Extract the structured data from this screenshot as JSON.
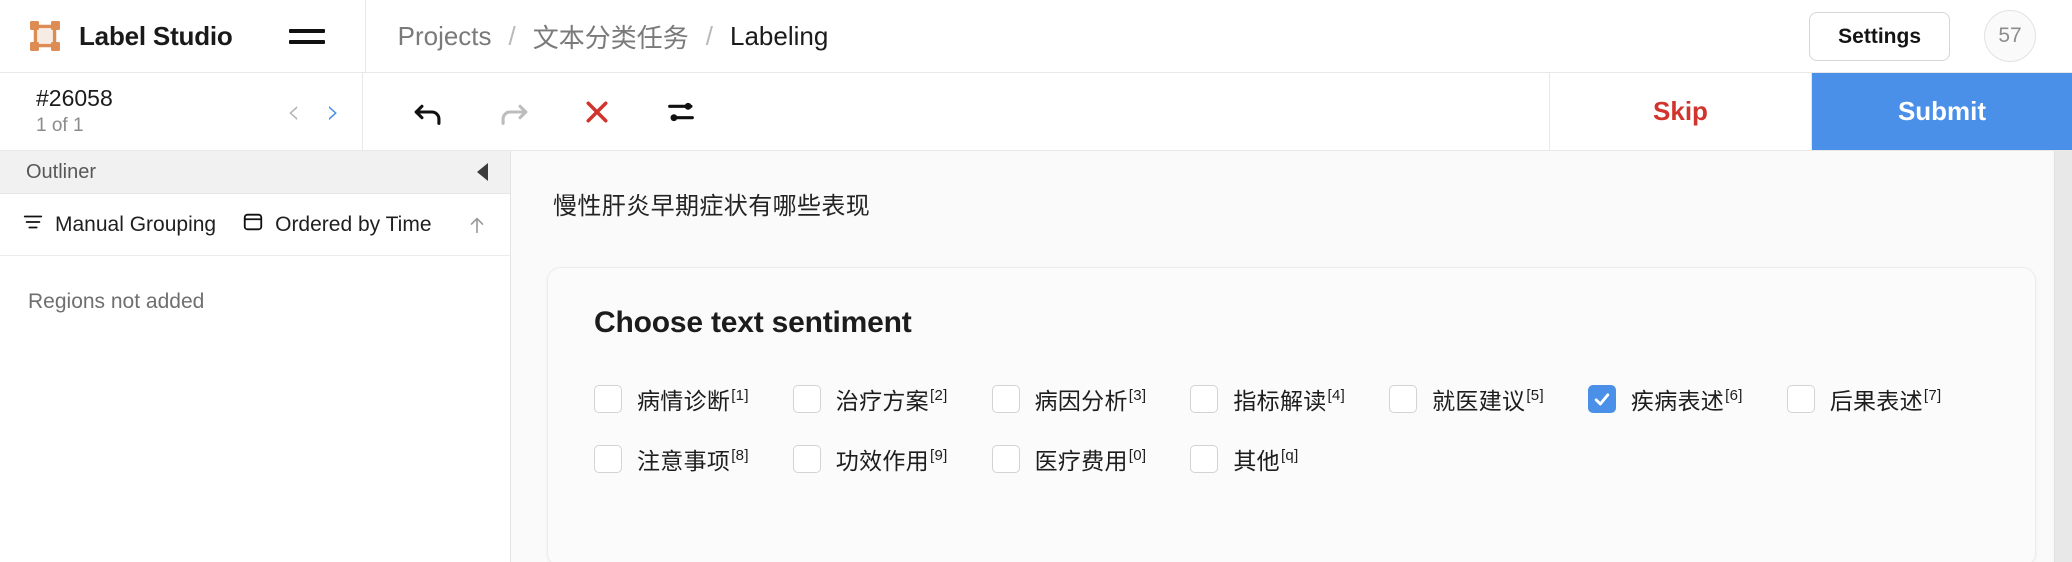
{
  "header": {
    "brand_name": "Label Studio",
    "logo_icon": "bounding-box-logo-icon",
    "menu_icon": "hamburger-menu-icon",
    "breadcrumb": [
      {
        "label": "Projects",
        "current": false
      },
      {
        "label": "文本分类任务",
        "current": false
      },
      {
        "label": "Labeling",
        "current": true
      }
    ],
    "breadcrumb_separator": "/",
    "settings_label": "Settings",
    "avatar_initials": "57"
  },
  "toolbar": {
    "task_id": "#26058",
    "task_position": "1 of 1",
    "prev_icon": "chevron-left-icon",
    "next_icon": "chevron-right-icon",
    "actions": [
      {
        "name": "undo-icon",
        "label": "Undo",
        "state": "enabled"
      },
      {
        "name": "redo-icon",
        "label": "Redo",
        "state": "disabled"
      },
      {
        "name": "reset-icon",
        "label": "Reset",
        "state": "danger"
      },
      {
        "name": "settings-sliders-icon",
        "label": "Settings",
        "state": "enabled"
      }
    ],
    "skip_label": "Skip",
    "submit_label": "Submit"
  },
  "sidebar": {
    "title": "Outliner",
    "collapse_icon": "collapse-left-icon",
    "grouping": {
      "icon": "list-lines-icon",
      "label": "Manual Grouping"
    },
    "ordering": {
      "icon": "window-panel-icon",
      "label": "Ordered by Time"
    },
    "sort_direction_icon": "arrow-up-icon",
    "empty_message": "Regions not added"
  },
  "main": {
    "source_text": "慢性肝炎早期症状有哪些表现",
    "card": {
      "title": "Choose text sentiment",
      "choices": [
        {
          "label": "病情诊断",
          "hotkey": "[1]",
          "checked": false
        },
        {
          "label": "治疗方案",
          "hotkey": "[2]",
          "checked": false
        },
        {
          "label": "病因分析",
          "hotkey": "[3]",
          "checked": false
        },
        {
          "label": "指标解读",
          "hotkey": "[4]",
          "checked": false
        },
        {
          "label": "就医建议",
          "hotkey": "[5]",
          "checked": false
        },
        {
          "label": "疾病表述",
          "hotkey": "[6]",
          "checked": true
        },
        {
          "label": "后果表述",
          "hotkey": "[7]",
          "checked": false
        },
        {
          "label": "注意事项",
          "hotkey": "[8]",
          "checked": false
        },
        {
          "label": "功效作用",
          "hotkey": "[9]",
          "checked": false
        },
        {
          "label": "医疗费用",
          "hotkey": "[0]",
          "checked": false
        },
        {
          "label": "其他",
          "hotkey": "[q]",
          "checked": false
        }
      ]
    }
  },
  "colors": {
    "accent_blue": "#4a90e8",
    "danger_red": "#d0342c",
    "logo_orange": "#dd8c54",
    "panel_bg": "#fafafa"
  }
}
